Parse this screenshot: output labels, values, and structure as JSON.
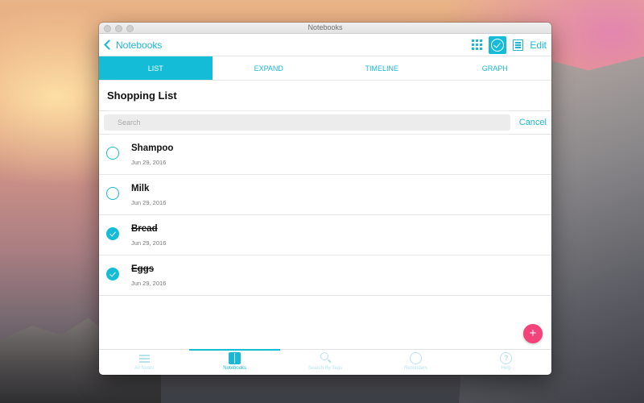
{
  "window": {
    "title": "Notebooks"
  },
  "navbar": {
    "back_label": "Notebooks",
    "edit_label": "Edit"
  },
  "tabs": [
    {
      "label": "LIST",
      "active": true
    },
    {
      "label": "EXPAND",
      "active": false
    },
    {
      "label": "TIMELINE",
      "active": false
    },
    {
      "label": "GRAPH",
      "active": false
    }
  ],
  "page": {
    "title": "Shopping List"
  },
  "search": {
    "placeholder": "Search",
    "value": "",
    "cancel_label": "Cancel"
  },
  "items": [
    {
      "title": "Shampoo",
      "date": "Jun 29, 2016",
      "done": false
    },
    {
      "title": "Milk",
      "date": "Jun 29, 2016",
      "done": false
    },
    {
      "title": "Bread",
      "date": "Jun 29, 2016",
      "done": true
    },
    {
      "title": "Eggs",
      "date": "Jun 29, 2016",
      "done": true
    }
  ],
  "fab": {
    "label": "+"
  },
  "bottom_tabs": [
    {
      "label": "All Notes",
      "icon": "menu-icon",
      "active": false
    },
    {
      "label": "Notebooks",
      "icon": "book-icon",
      "active": true
    },
    {
      "label": "Search By Tags",
      "icon": "search-icon",
      "active": false
    },
    {
      "label": "Reminders",
      "icon": "alarm-icon",
      "active": false
    },
    {
      "label": "Help",
      "icon": "help-icon",
      "active": false
    }
  ],
  "colors": {
    "accent": "#14bcd8",
    "fab": "#f2447a"
  }
}
